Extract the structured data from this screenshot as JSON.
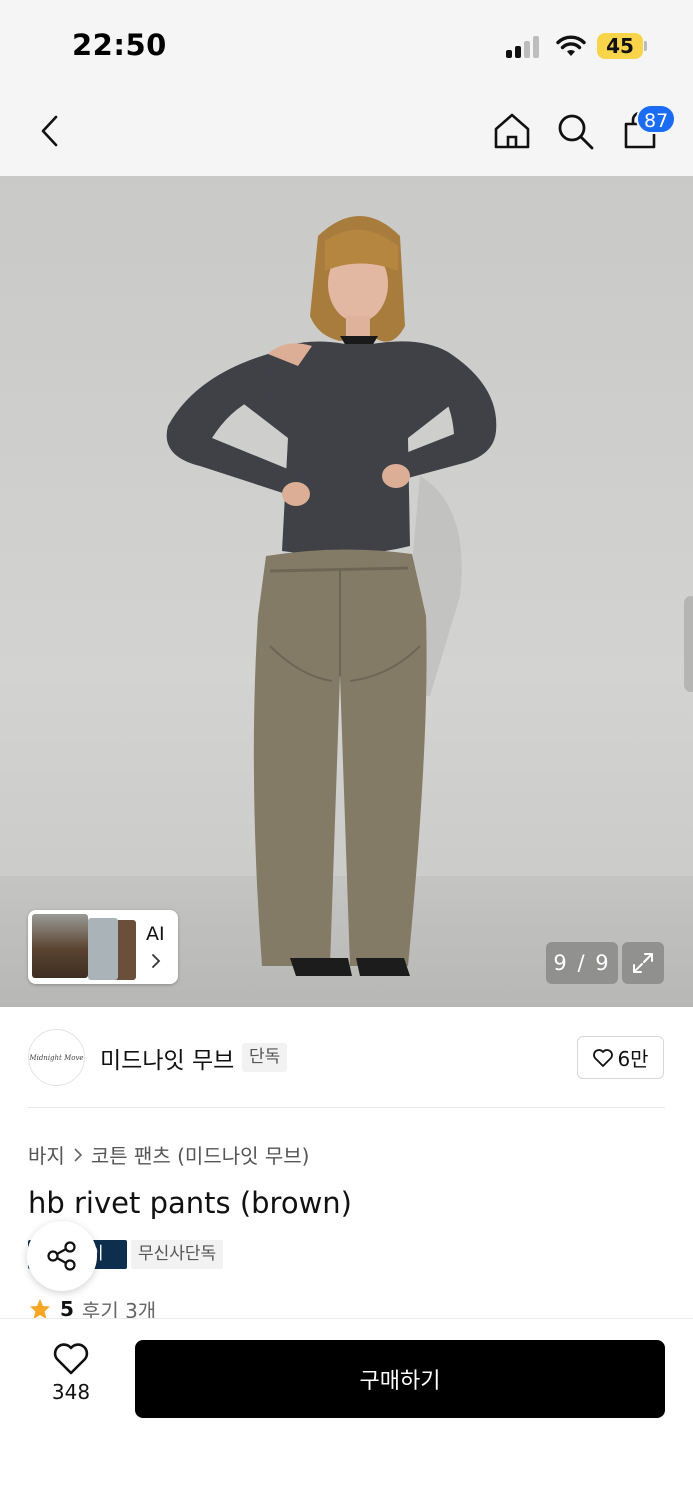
{
  "status_bar": {
    "time": "22:50",
    "battery_level": "45",
    "battery_color": "#f7d44a"
  },
  "nav": {
    "back_icon": "chevron-left-icon",
    "home_icon": "home-icon",
    "search_icon": "search-icon",
    "cart_icon": "shopping-bag-icon",
    "cart_count": "87",
    "badge_color": "#1a6cf5"
  },
  "gallery": {
    "ai_label": "AI",
    "counter": "9 / 9",
    "expand_icon": "expand-icon"
  },
  "brand": {
    "logo_text": "Midnight Move",
    "name": "미드나잇 무브",
    "exclusive_tag": "단독",
    "likes": "6만"
  },
  "product": {
    "breadcrumb": [
      "바지",
      "코튼 팬츠 (미드나잇 무브)"
    ],
    "title": "hb rivet pants (brown)",
    "tags": [
      "이",
      "무신사단독"
    ],
    "rating": "5",
    "reviews": "후기 3개"
  },
  "bottom": {
    "wish_count": "348",
    "buy_label": "구매하기"
  }
}
